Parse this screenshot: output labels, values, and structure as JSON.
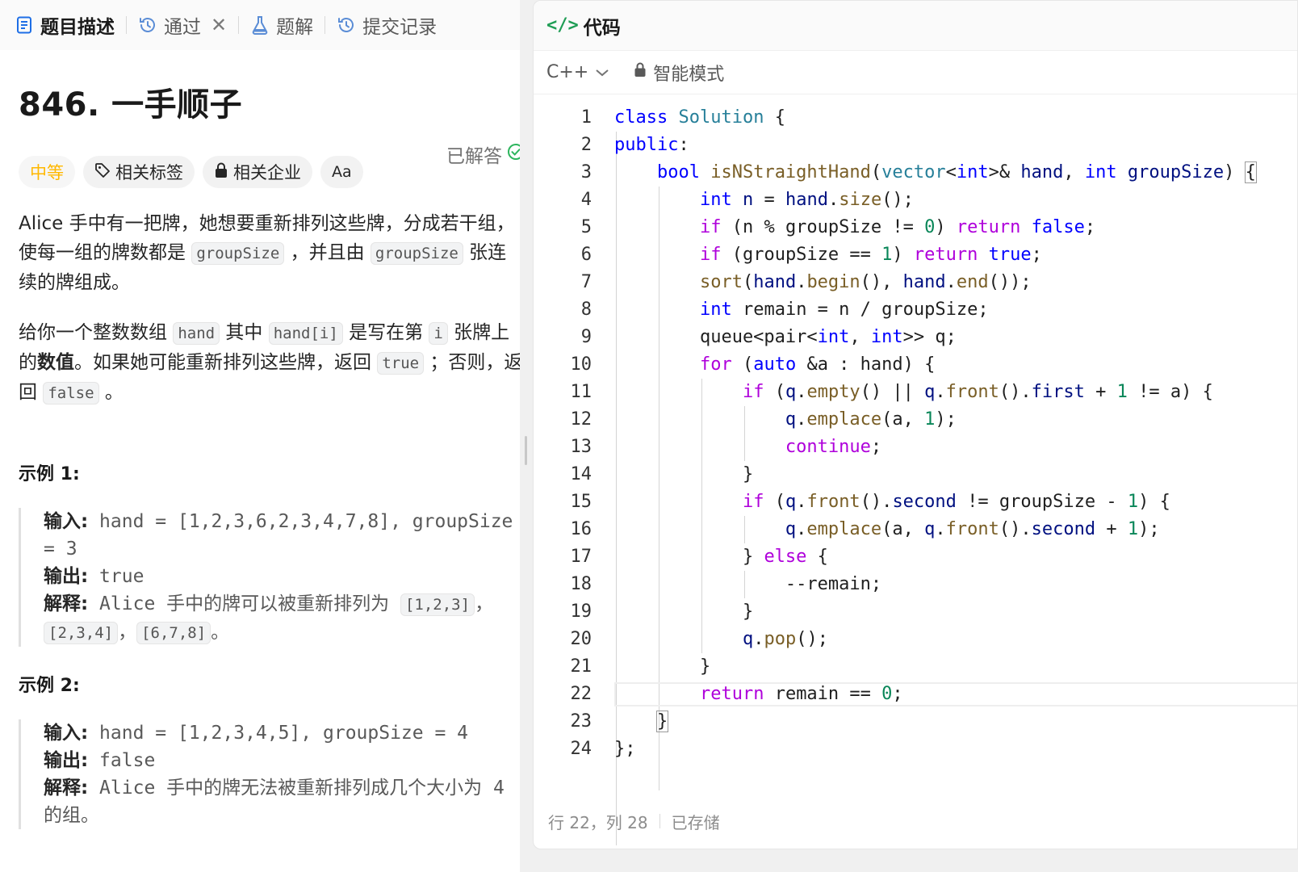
{
  "tabs": [
    {
      "label": "题目描述",
      "icon": "document-icon",
      "active": true
    },
    {
      "label": "通过",
      "icon": "history-icon",
      "closable": true
    },
    {
      "label": "题解",
      "icon": "flask-icon"
    },
    {
      "label": "提交记录",
      "icon": "history-icon"
    }
  ],
  "problem": {
    "title": "846. 一手顺子",
    "solved_label": "已解答",
    "difficulty": "中等",
    "tag_related": "相关标签",
    "tag_company": "相关企业",
    "tag_font": "Aa",
    "desc": {
      "p1_a": "Alice 手中有一把牌，她想要重新排列这些牌，分成若干组，使每一组的牌数都是 ",
      "p1_code1": "groupSize",
      "p1_b": " ，并且由 ",
      "p1_code2": "groupSize",
      "p1_c": " 张连续的牌组成。",
      "p2_a": "给你一个整数数组 ",
      "p2_code1": "hand",
      "p2_b": " 其中 ",
      "p2_code2": "hand[i]",
      "p2_c": " 是写在第 ",
      "p2_code3": "i",
      "p2_d": " 张牌上的",
      "p2_bold": "数值",
      "p2_e": "。如果她可能重新排列这些牌，返回 ",
      "p2_code4": "true",
      "p2_f": " ；否则，返回 ",
      "p2_code5": "false",
      "p2_g": " 。"
    },
    "examples": [
      {
        "title": "示例 1:",
        "input_label": "输入:",
        "input": " hand = [1,2,3,6,2,3,4,7,8], groupSize = 3",
        "output_label": "输出:",
        "output": " true",
        "explain_label": "解释:",
        "explain_text": " Alice 手中的牌可以被重新排列为 ",
        "explain_code1": "[1,2,3]",
        "explain_sep1": "，",
        "explain_code2": "[2,3,4]",
        "explain_sep2": "，",
        "explain_code3": "[6,7,8]",
        "explain_end": "。"
      },
      {
        "title": "示例 2:",
        "input_label": "输入:",
        "input": " hand = [1,2,3,4,5], groupSize = 4",
        "output_label": "输出:",
        "output": " false",
        "explain_label": "解释:",
        "explain_text": " Alice 手中的牌无法被重新排列成几个大小为 4 的组。"
      }
    ]
  },
  "editor": {
    "title": "代码",
    "language": "C++",
    "mode": "智能模式",
    "status_position": "行 22，列 28",
    "status_saved": "已存储",
    "current_line": 22
  }
}
